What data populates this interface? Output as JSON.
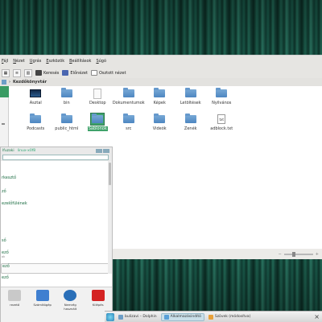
{
  "menubar": [
    "Fájl",
    "Nézet",
    "Ugrás",
    "Eszközök",
    "Beállítások",
    "Súgó"
  ],
  "toolbar": {
    "search": "Keresés",
    "preview": "Előnézet",
    "split": "Osztott nézet"
  },
  "address": {
    "label": "Kezdőkönyvtár"
  },
  "files": [
    {
      "name": "Asztal",
      "icon": "desktop"
    },
    {
      "name": "bin",
      "icon": "folder"
    },
    {
      "name": "Desktop",
      "icon": "document"
    },
    {
      "name": "Dokumentumok",
      "icon": "folder"
    },
    {
      "name": "Képek",
      "icon": "folder"
    },
    {
      "name": "Letöltések",
      "icon": "folder"
    },
    {
      "name": "Nyilvános",
      "icon": "folder"
    },
    {
      "name": "",
      "icon": "none"
    },
    {
      "name": "",
      "icon": "none"
    },
    {
      "name": "",
      "icon": "none"
    },
    {
      "name": "Podcasts",
      "icon": "folder"
    },
    {
      "name": "public_html",
      "icon": "folder"
    },
    {
      "name": "Sablonok",
      "icon": "folder",
      "selected": true
    },
    {
      "name": "src",
      "icon": "folder"
    },
    {
      "name": "Videók",
      "icon": "folder"
    },
    {
      "name": "Zenék",
      "icon": "folder"
    },
    {
      "name": "adblock.txt",
      "icon": "text"
    }
  ],
  "kickoff": {
    "header_user": "lfuzaki",
    "header_host": "linux-x0f8",
    "search_placeholder": "",
    "entries": [
      {
        "label": "rkesztő",
        "sub": ""
      },
      {
        "label": "ző",
        "sub": ""
      },
      {
        "label": "ezelőfülének",
        "sub": ""
      },
      {
        "label": "ső",
        "sub": ""
      },
      {
        "label": "ező",
        "sub": "ok"
      },
      {
        "label": "ező",
        "sub": ""
      },
      {
        "label": "ező",
        "sub": ""
      }
    ],
    "tabs": [
      {
        "label": "rezető",
        "color": "#c9c9c9"
      },
      {
        "label": "Számítógép",
        "color": "#3f7fd0"
      },
      {
        "label": "Nemrég használt",
        "color": "#2a6fb8"
      },
      {
        "label": "Kilépés",
        "color": "#d42323"
      }
    ]
  },
  "taskbar": {
    "tasks": [
      {
        "label": "bulizavi – Dolphin",
        "color": "#6d9ec6",
        "active": false
      },
      {
        "label": "Alkalmazásindító",
        "color": "#5aa0d8",
        "active": true
      },
      {
        "label": "Szövek (módosítva)",
        "color": "#e8a13b",
        "active": false
      }
    ],
    "close_glyph": "×"
  },
  "colors": {
    "accent": "#3fa26a",
    "wallpaper": "#1a5a4a"
  }
}
